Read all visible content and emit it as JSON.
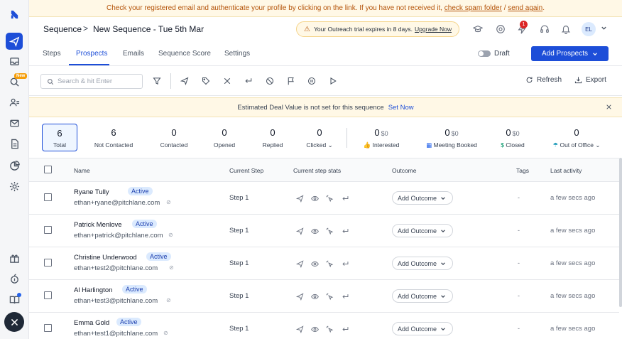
{
  "top_banner": {
    "text": "Check your registered email and authenticate your profile by clicking on the link. If you have not received it,",
    "link1": "check spam folder",
    "sep": "/",
    "link2": "send again",
    "end": "."
  },
  "breadcrumb": {
    "root": "Sequence",
    "sep": ">",
    "name": "New Sequence - Tue 5th Mar"
  },
  "trial": {
    "text": "Your Outreach trial expires in 8 days.",
    "link": "Upgrade Now"
  },
  "header": {
    "notification_count": "1",
    "avatar_initials": "EL"
  },
  "sidebar": {
    "new_badge": "New"
  },
  "tabs": [
    "Steps",
    "Prospects",
    "Emails",
    "Sequence Score",
    "Settings"
  ],
  "draft_label": "Draft",
  "add_prospects_label": "Add Prospects",
  "search": {
    "placeholder": "Search & hit Enter"
  },
  "toolbar": {
    "refresh": "Refresh",
    "export": "Export"
  },
  "deal_banner": {
    "text": "Estimated Deal Value is not set for this sequence",
    "link": "Set Now"
  },
  "stats": {
    "total": {
      "value": "6",
      "label": "Total"
    },
    "not_contacted": {
      "value": "6",
      "label": "Not Contacted"
    },
    "contacted": {
      "value": "0",
      "label": "Contacted"
    },
    "opened": {
      "value": "0",
      "label": "Opened"
    },
    "replied": {
      "value": "0",
      "label": "Replied"
    },
    "clicked": {
      "value": "0",
      "label": "Clicked"
    },
    "interested": {
      "value": "0",
      "amount": "$0",
      "label": "Interested"
    },
    "meeting_booked": {
      "value": "0",
      "amount": "$0",
      "label": "Meeting Booked"
    },
    "closed": {
      "value": "0",
      "amount": "$0",
      "label": "Closed"
    },
    "out_of_office": {
      "value": "0",
      "label": "Out of Office"
    }
  },
  "table": {
    "headers": {
      "name": "Name",
      "current_step": "Current Step",
      "stats": "Current step stats",
      "outcome": "Outcome",
      "tags": "Tags",
      "last_activity": "Last activity"
    },
    "rows": [
      {
        "name": "Ryane Tully",
        "status": "Active",
        "email": "ethan+ryane@pitchlane.com",
        "step": "Step 1",
        "outcome": "Add Outcome",
        "tags": "-",
        "last": "a few secs ago"
      },
      {
        "name": "Patrick Menlove",
        "status": "Active",
        "email": "ethan+patrick@pitchlane.com",
        "step": "Step 1",
        "outcome": "Add Outcome",
        "tags": "-",
        "last": "a few secs ago"
      },
      {
        "name": "Christine Underwood",
        "status": "Active",
        "email": "ethan+test2@pitchlane.com",
        "step": "Step 1",
        "outcome": "Add Outcome",
        "tags": "-",
        "last": "a few secs ago"
      },
      {
        "name": "Al Harlington",
        "status": "Active",
        "email": "ethan+test3@pitchlane.com",
        "step": "Step 1",
        "outcome": "Add Outcome",
        "tags": "-",
        "last": "a few secs ago"
      },
      {
        "name": "Emma Gold",
        "status": "Active",
        "email": "ethan+test1@pitchlane.com",
        "step": "Step 1",
        "outcome": "Add Outcome",
        "tags": "-",
        "last": "a few secs ago"
      }
    ]
  },
  "colors": {
    "accent": "#1d4ed8",
    "banner_bg": "#fff8e6",
    "banner_text": "#b45309",
    "badge_bg": "#dbeafe"
  }
}
